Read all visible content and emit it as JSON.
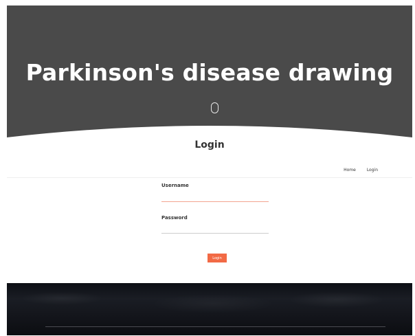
{
  "hero": {
    "title": "Parkinson's disease drawing"
  },
  "login": {
    "heading": "Login",
    "username_label": "Username",
    "username_value": "",
    "password_label": "Password",
    "password_value": "",
    "submit_label": "Login"
  },
  "nav": {
    "items": [
      {
        "label": "Home"
      },
      {
        "label": "Login"
      }
    ]
  },
  "colors": {
    "hero_bg": "#4a4a4a",
    "accent": "#f26a45",
    "footer_bg": "#0d0f14"
  }
}
